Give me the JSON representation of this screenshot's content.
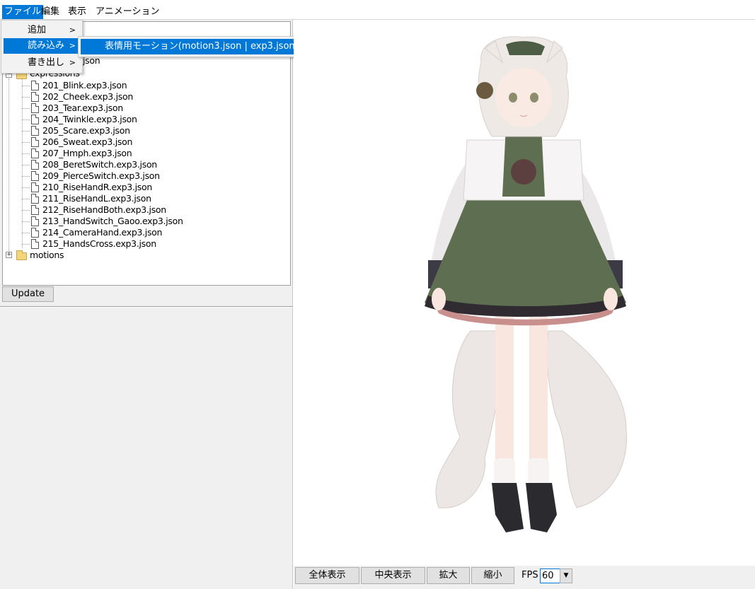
{
  "menubar": {
    "items": [
      "ファイル",
      "編集",
      "表示",
      "アニメーション"
    ]
  },
  "file_menu": {
    "items": [
      {
        "label": "追加",
        "arrow": ">"
      },
      {
        "label": "読み込み",
        "arrow": ">"
      },
      {
        "label": "書き出し",
        "arrow": ">"
      }
    ]
  },
  "submenu": {
    "item": "表情用モーション(motion3.json | exp3.json)"
  },
  "tree": {
    "partial_header": "json",
    "expressions_folder": "expressions",
    "files": [
      "201_Blink.exp3.json",
      "202_Cheek.exp3.json",
      "203_Tear.exp3.json",
      "204_Twinkle.exp3.json",
      "205_Scare.exp3.json",
      "206_Sweat.exp3.json",
      "207_Hmph.exp3.json",
      "208_BeretSwitch.exp3.json",
      "209_PierceSwitch.exp3.json",
      "210_RiseHandR.exp3.json",
      "211_RiseHandL.exp3.json",
      "212_RiseHandBoth.exp3.json",
      "213_HandSwitch_Gaoo.exp3.json",
      "214_CameraHand.exp3.json",
      "215_HandsCross.exp3.json"
    ],
    "motions_folder": "motions",
    "expand_symbol": "+"
  },
  "left": {
    "update_label": "Update"
  },
  "viewer_controls": {
    "fit_all": "全体表示",
    "center": "中央表示",
    "zoom_in": "拡大",
    "zoom_out": "縮小",
    "fps_label": "FPS",
    "fps_value": "60",
    "dropdown_arrow": "▼"
  },
  "colors": {
    "accent": "#0078d7",
    "panel_bg": "#f0f0f0",
    "skirt_green": "#5e6e50",
    "hair_white": "#efe9e6"
  }
}
